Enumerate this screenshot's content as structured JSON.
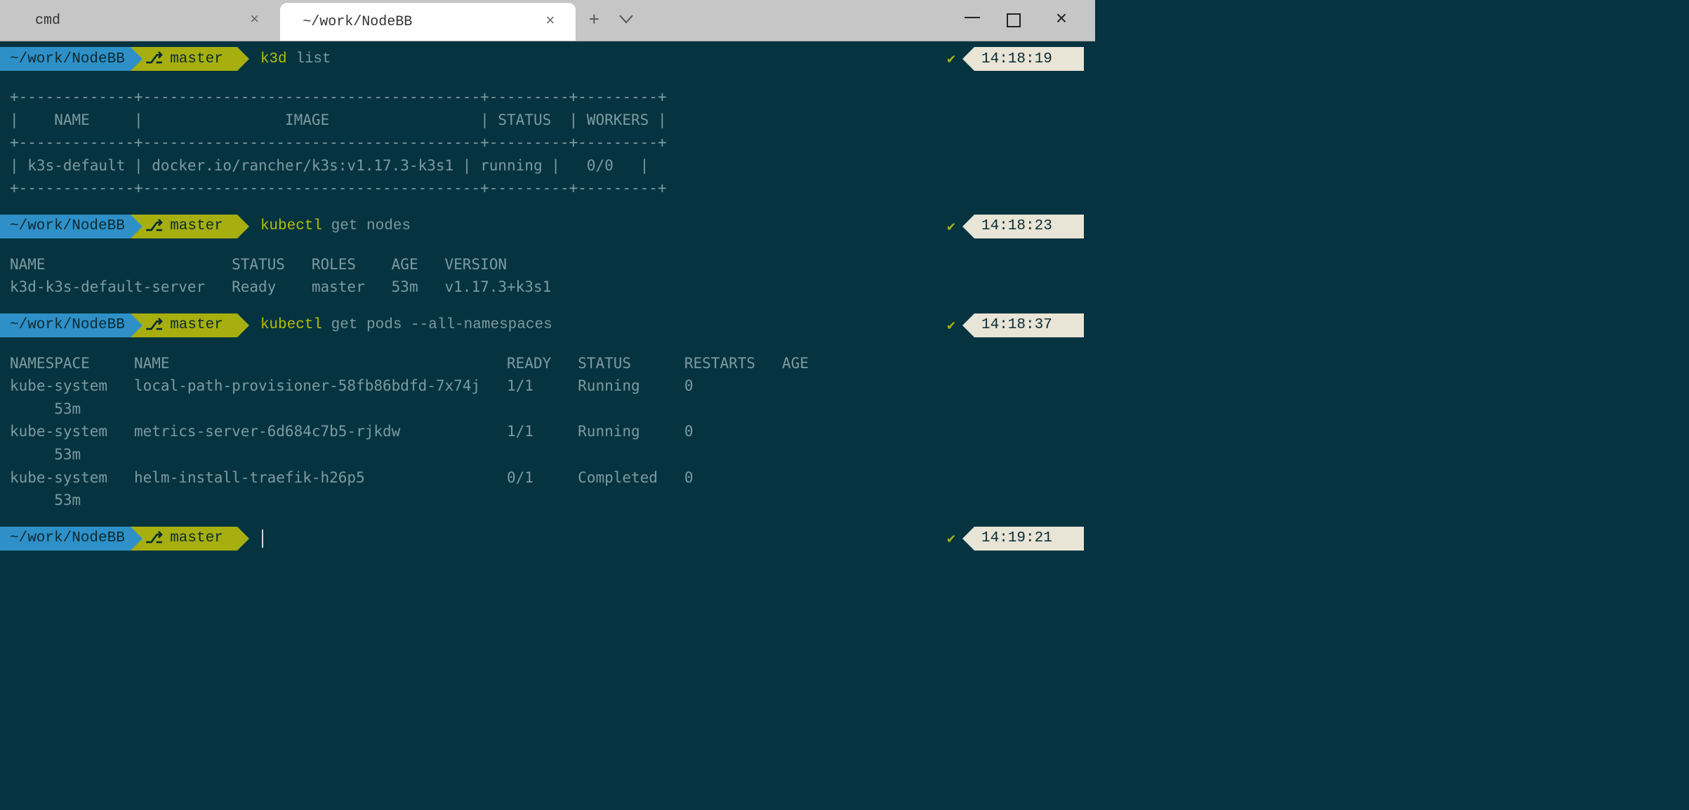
{
  "tabs": [
    {
      "title": "cmd",
      "active": false
    },
    {
      "title": "~/work/NodeBB",
      "active": true
    }
  ],
  "colors": {
    "terminal_bg": "#053440",
    "prompt_blue": "#2e90c7",
    "prompt_olive": "#a7af10",
    "timestamp_bg": "#e8e4d6"
  },
  "prompts": [
    {
      "path": "~/work/NodeBB",
      "branch": "master",
      "cmd_bin": "k3d",
      "cmd_args": " list",
      "status_ok": true,
      "time": "14:18:19",
      "output": "+-------------+--------------------------------------+---------+---------+\n|    NAME     |                IMAGE                 | STATUS  | WORKERS |\n+-------------+--------------------------------------+---------+---------+\n| k3s-default | docker.io/rancher/k3s:v1.17.3-k3s1 | running |   0/0   |\n+-------------+--------------------------------------+---------+---------+"
    },
    {
      "path": "~/work/NodeBB",
      "branch": "master",
      "cmd_bin": "kubectl",
      "cmd_args": " get nodes",
      "status_ok": true,
      "time": "14:18:23",
      "output": "NAME                     STATUS   ROLES    AGE   VERSION\nk3d-k3s-default-server   Ready    master   53m   v1.17.3+k3s1"
    },
    {
      "path": "~/work/NodeBB",
      "branch": "master",
      "cmd_bin": "kubectl",
      "cmd_args": " get pods --all-namespaces",
      "status_ok": true,
      "time": "14:18:37",
      "output": "NAMESPACE     NAME                                      READY   STATUS      RESTARTS   AGE\nkube-system   local-path-provisioner-58fb86bdfd-7x74j   1/1     Running     0\n     53m\nkube-system   metrics-server-6d684c7b5-rjkdw            1/1     Running     0\n     53m\nkube-system   helm-install-traefik-h26p5                0/1     Completed   0\n     53m"
    },
    {
      "path": "~/work/NodeBB",
      "branch": "master",
      "cmd_bin": "",
      "cmd_args": "",
      "status_ok": true,
      "time": "14:19:21",
      "output": "",
      "cursor": true
    }
  ]
}
